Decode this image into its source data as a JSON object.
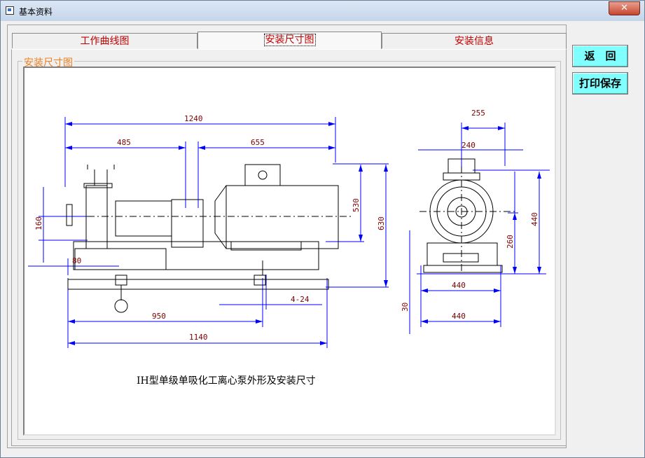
{
  "window": {
    "title": "基本资料",
    "close_label": "✕"
  },
  "tabs": [
    {
      "label": "工作曲线图",
      "active": false
    },
    {
      "label": "安装尺寸图",
      "active": true
    },
    {
      "label": "安装信息",
      "active": false
    }
  ],
  "group": {
    "label": "安装尺寸图"
  },
  "buttons": {
    "back": "返　回",
    "print_save": "打印保存"
  },
  "drawing": {
    "caption": "IH型单级单吸化工离心泵外形及安装尺寸",
    "dims": {
      "total_length": "1240",
      "pump_length": "485",
      "motor_length": "655",
      "height_160": "160",
      "width_80": "80",
      "height_530": "530",
      "height_630": "630",
      "holes": "4-24",
      "span_950": "950",
      "base_1140": "1140",
      "top_255": "255",
      "top_240": "240",
      "height_440": "440",
      "height_260": "260",
      "base_440_a": "440",
      "base_440_b": "440",
      "height_30": "30"
    }
  }
}
